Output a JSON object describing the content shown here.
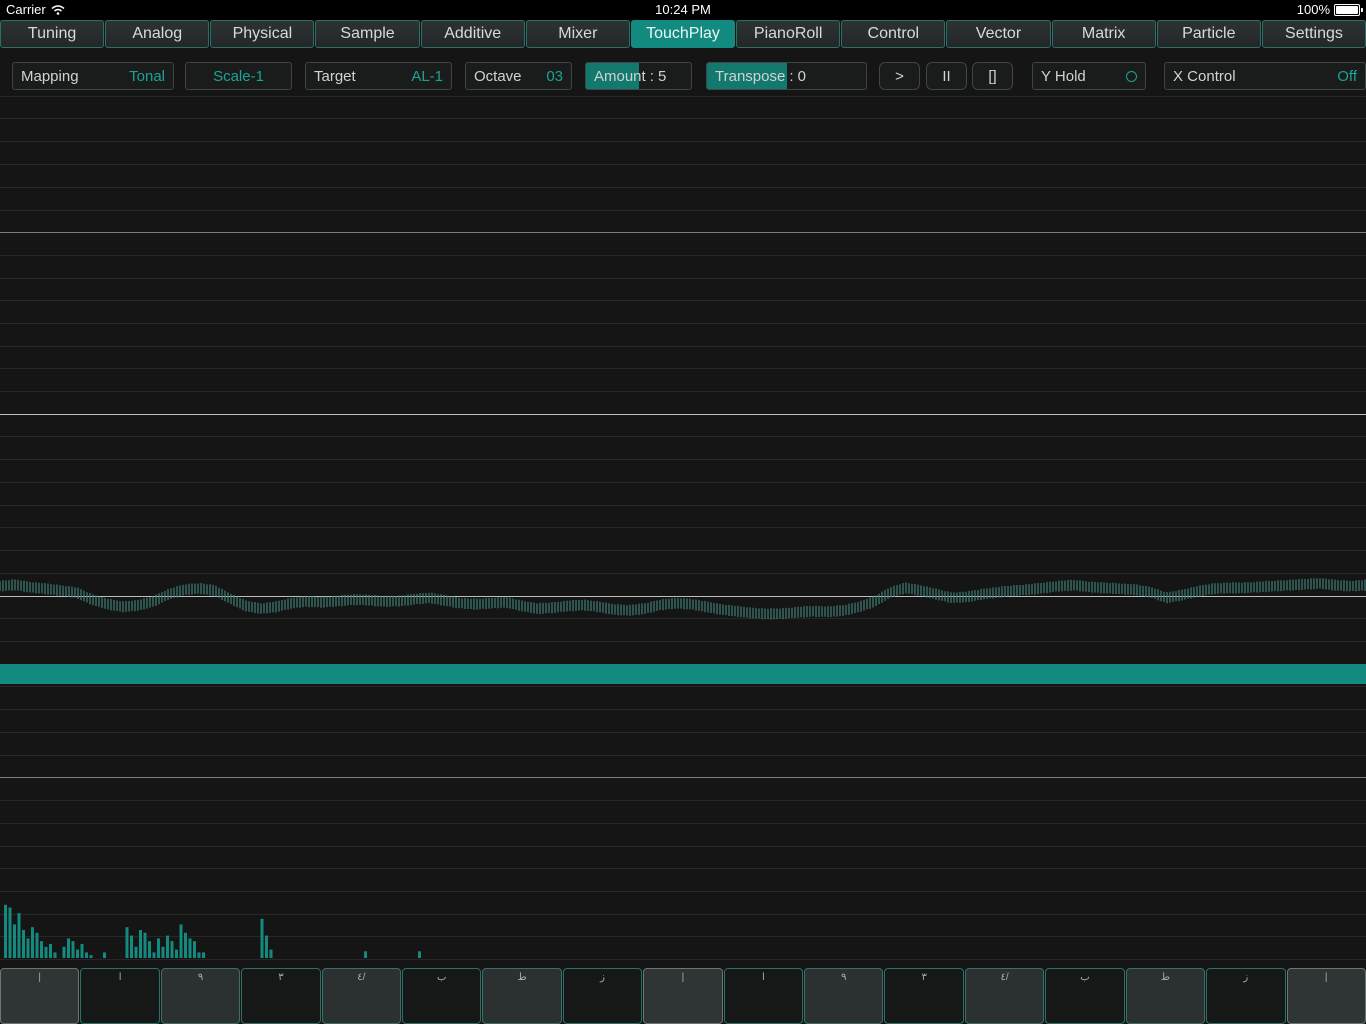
{
  "status_bar": {
    "carrier": "Carrier",
    "time": "10:24 PM",
    "battery": "100%"
  },
  "tabs": [
    {
      "label": "Tuning"
    },
    {
      "label": "Analog"
    },
    {
      "label": "Physical"
    },
    {
      "label": "Sample"
    },
    {
      "label": "Additive"
    },
    {
      "label": "Mixer"
    },
    {
      "label": "TouchPlay",
      "active": true
    },
    {
      "label": "PianoRoll"
    },
    {
      "label": "Control"
    },
    {
      "label": "Vector"
    },
    {
      "label": "Matrix"
    },
    {
      "label": "Particle"
    },
    {
      "label": "Settings"
    }
  ],
  "controls": {
    "mapping": {
      "label": "Mapping",
      "value": "Tonal"
    },
    "scale": {
      "value": "Scale-1"
    },
    "target": {
      "label": "Target",
      "value": "AL-1"
    },
    "octave": {
      "label": "Octave",
      "value": "03"
    },
    "amount": {
      "label": "Amount",
      "value": ": 5",
      "level": 0.5
    },
    "transpose": {
      "label": "Transpose",
      "value": ": 0",
      "level": 0.5
    },
    "play": {
      "label": ">"
    },
    "pause": {
      "label": "II"
    },
    "stop": {
      "label": "[]"
    },
    "y_hold": {
      "label": "Y Hold"
    },
    "x_control": {
      "label": "X Control",
      "value": "Off"
    }
  },
  "colors": {
    "accent": "#138a7f",
    "accent_text": "#1aa394",
    "background": "#151515"
  },
  "keyboard": {
    "keys": [
      {
        "label": "|",
        "style": "root"
      },
      {
        "label": "ا",
        "style": "dark"
      },
      {
        "label": "٩",
        "style": "light"
      },
      {
        "label": "٣",
        "style": "dark"
      },
      {
        "label": "٤/",
        "style": "light"
      },
      {
        "label": "ب",
        "style": "dark"
      },
      {
        "label": "ط",
        "style": "light"
      },
      {
        "label": "ز",
        "style": "dark"
      },
      {
        "label": "|",
        "style": "root"
      },
      {
        "label": "ا",
        "style": "dark"
      },
      {
        "label": "٩",
        "style": "light"
      },
      {
        "label": "٣",
        "style": "dark"
      },
      {
        "label": "٤/",
        "style": "light"
      },
      {
        "label": "ب",
        "style": "dark"
      },
      {
        "label": "ط",
        "style": "light"
      },
      {
        "label": "ز",
        "style": "dark"
      },
      {
        "label": "|",
        "style": "root"
      }
    ]
  },
  "waveform": {
    "amplitudes": [
      0.55,
      0.62,
      0.48,
      0.4,
      0.3,
      0.18,
      -0.2,
      -0.45,
      -0.6,
      -0.52,
      -0.3,
      0.1,
      0.35,
      0.42,
      0.3,
      -0.15,
      -0.55,
      -0.7,
      -0.6,
      -0.4,
      -0.3,
      -0.35,
      -0.28,
      -0.2,
      -0.22,
      -0.3,
      -0.28,
      -0.18,
      -0.1,
      -0.25,
      -0.4,
      -0.45,
      -0.4,
      -0.35,
      -0.55,
      -0.7,
      -0.65,
      -0.55,
      -0.5,
      -0.6,
      -0.75,
      -0.8,
      -0.7,
      -0.5,
      -0.4,
      -0.45,
      -0.6,
      -0.75,
      -0.85,
      -0.95,
      -1.0,
      -0.98,
      -0.9,
      -0.85,
      -0.88,
      -0.8,
      -0.6,
      -0.3,
      0.2,
      0.45,
      0.3,
      0.1,
      -0.1,
      -0.05,
      0.1,
      0.2,
      0.3,
      0.35,
      0.45,
      0.55,
      0.6,
      0.5,
      0.45,
      0.4,
      0.35,
      0.2,
      -0.1,
      0.05,
      0.25,
      0.4,
      0.45,
      0.45,
      0.5,
      0.55,
      0.6,
      0.65,
      0.7,
      0.6,
      0.55,
      0.6
    ],
    "spectrum": [
      0.95,
      0.9,
      0.6,
      0.8,
      0.5,
      0.35,
      0.55,
      0.45,
      0.3,
      0.2,
      0.25,
      0.1,
      0,
      0.2,
      0.35,
      0.3,
      0.15,
      0.25,
      0.1,
      0.05,
      0,
      0,
      0.1,
      0,
      0,
      0,
      0,
      0.55,
      0.4,
      0.2,
      0.5,
      0.45,
      0.3,
      0.1,
      0.35,
      0.2,
      0.4,
      0.3,
      0.15,
      0.6,
      0.45,
      0.35,
      0.3,
      0.1,
      0.1,
      0,
      0,
      0,
      0,
      0,
      0,
      0,
      0,
      0,
      0,
      0,
      0,
      0.7,
      0.4,
      0.15,
      0,
      0,
      0,
      0,
      0,
      0,
      0,
      0,
      0,
      0,
      0,
      0,
      0,
      0,
      0,
      0,
      0,
      0,
      0,
      0,
      0.12,
      0,
      0,
      0,
      0,
      0,
      0,
      0,
      0,
      0,
      0,
      0,
      0.12
    ]
  }
}
